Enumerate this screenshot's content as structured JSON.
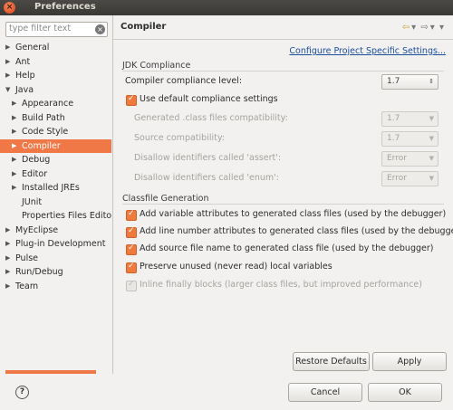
{
  "window": {
    "title": "Preferences",
    "close_glyph": "×"
  },
  "filter": {
    "placeholder": "type filter text",
    "clear_glyph": "×"
  },
  "tree": [
    {
      "label": "General",
      "arrow": "▶",
      "depth": 0
    },
    {
      "label": "Ant",
      "arrow": "▶",
      "depth": 0
    },
    {
      "label": "Help",
      "arrow": "▶",
      "depth": 0
    },
    {
      "label": "Java",
      "arrow": "▼",
      "depth": 0
    },
    {
      "label": "Appearance",
      "arrow": "▶",
      "depth": 1
    },
    {
      "label": "Build Path",
      "arrow": "▶",
      "depth": 1
    },
    {
      "label": "Code Style",
      "arrow": "▶",
      "depth": 1
    },
    {
      "label": "Compiler",
      "arrow": "▶",
      "depth": 1,
      "selected": true
    },
    {
      "label": "Debug",
      "arrow": "▶",
      "depth": 1
    },
    {
      "label": "Editor",
      "arrow": "▶",
      "depth": 1
    },
    {
      "label": "Installed JREs",
      "arrow": "▶",
      "depth": 1
    },
    {
      "label": "JUnit",
      "arrow": "",
      "depth": 1
    },
    {
      "label": "Properties Files Edito",
      "arrow": "",
      "depth": 1
    },
    {
      "label": "MyEclipse",
      "arrow": "▶",
      "depth": 0
    },
    {
      "label": "Plug-in Development",
      "arrow": "▶",
      "depth": 0
    },
    {
      "label": "Pulse",
      "arrow": "▶",
      "depth": 0
    },
    {
      "label": "Run/Debug",
      "arrow": "▶",
      "depth": 0
    },
    {
      "label": "Team",
      "arrow": "▶",
      "depth": 0
    }
  ],
  "page": {
    "title": "Compiler",
    "nav": {
      "back": "⇦",
      "back_menu": "▾",
      "forward": "⇨",
      "forward_menu": "▾",
      "menu": "▾"
    },
    "configure_link": "Configure Project Specific Settings..."
  },
  "jdk": {
    "group_title": "JDK Compliance",
    "compliance_label": "Compiler compliance level:",
    "compliance_value": "1.7",
    "use_default_label": "Use default compliance settings",
    "use_default_checked": true,
    "generated_label": "Generated .class files compatibility:",
    "generated_value": "1.7",
    "source_label": "Source compatibility:",
    "source_value": "1.7",
    "assert_label": "Disallow identifiers called 'assert':",
    "assert_value": "Error",
    "enum_label": "Disallow identifiers called 'enum':",
    "enum_value": "Error"
  },
  "classfile": {
    "group_title": "Classfile Generation",
    "options": [
      {
        "label": "Add variable attributes to generated class files (used by the debugger)",
        "checked": true,
        "enabled": true
      },
      {
        "label": "Add line number attributes to generated class files (used by the debugger)",
        "checked": true,
        "enabled": true
      },
      {
        "label": "Add source file name to generated class file (used by the debugger)",
        "checked": true,
        "enabled": true
      },
      {
        "label": "Preserve unused (never read) local variables",
        "checked": true,
        "enabled": true
      },
      {
        "label": "Inline finally blocks (larger class files, but improved performance)",
        "checked": true,
        "enabled": false
      }
    ]
  },
  "buttons": {
    "restore_defaults": "Restore Defaults",
    "apply": "Apply",
    "cancel": "Cancel",
    "ok": "OK",
    "help": "?"
  },
  "colors": {
    "accent": "#f07746",
    "link": "#1a4d9c"
  }
}
